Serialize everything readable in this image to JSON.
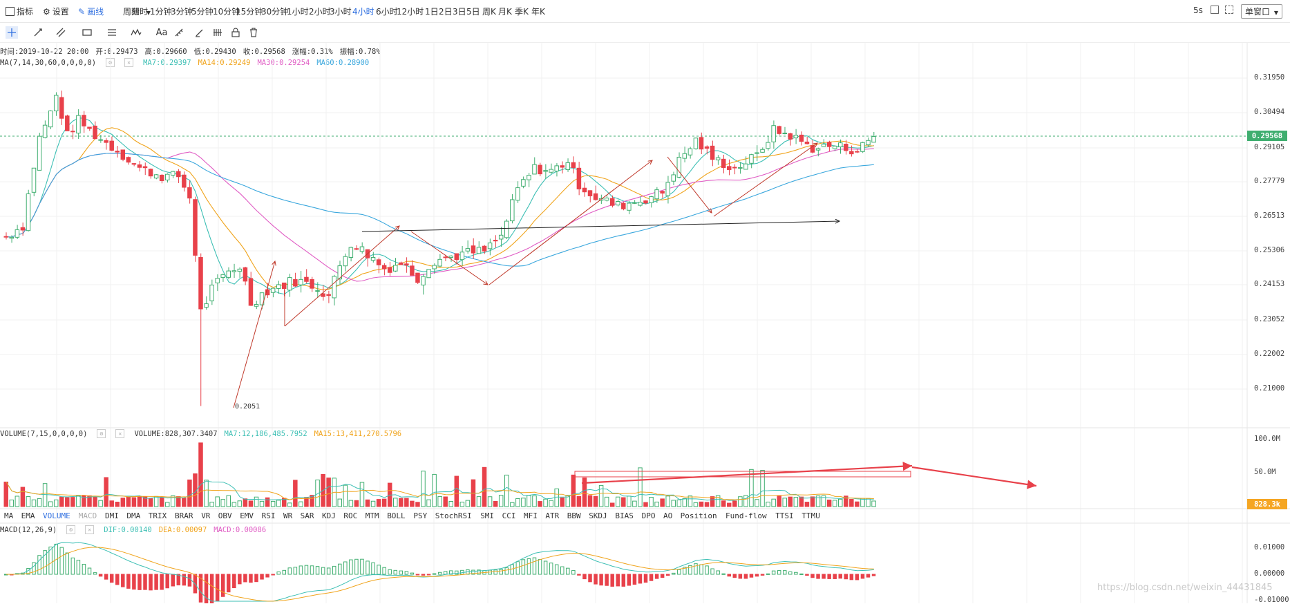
{
  "toolbar": {
    "indicator_label": "指标",
    "settings_label": "设置",
    "draw_label": "画线",
    "period_label": "周期",
    "periods": [
      "分时",
      "1分钟",
      "3分钟",
      "5分钟",
      "10分钟",
      "15分钟",
      "30分钟",
      "1小时",
      "2小时",
      "3小时",
      "4小时",
      "6小时",
      "12小时",
      "1日",
      "2日",
      "3日",
      "5日",
      "周K",
      "月K",
      "季K",
      "年K"
    ],
    "active_period": "4小时",
    "refresh": "5s",
    "window_mode": "单窗口"
  },
  "candle_info": {
    "time": "时间:2019-10-22 20:00",
    "open": "开:0.29473",
    "high": "高:0.29660",
    "low": "低:0.29430",
    "close": "收:0.29568",
    "change": "涨幅:0.31%",
    "amplitude": "振幅:0.78%"
  },
  "ma_info": {
    "params": "MA(7,14,30,60,0,0,0,0)",
    "ma7": "MA7:0.29397",
    "ma14": "MA14:0.29249",
    "ma30": "MA30:0.29254",
    "ma60": "MA60:0.28900"
  },
  "price_axis": [
    "0.31950",
    "0.30494",
    "0.29105",
    "0.27779",
    "0.26513",
    "0.25306",
    "0.24153",
    "0.23052",
    "0.22002",
    "0.21000"
  ],
  "current_price": "0.29568",
  "low_marker": "0.2051",
  "volume_info": {
    "params": "VOLUME(7,15,0,0,0,0)",
    "volume": "VOLUME:828,307.3407",
    "ma7": "MA7:12,186,485.7952",
    "ma15": "MA15:13,411,270.5796"
  },
  "volume_axis": [
    "100.0M",
    "50.0M"
  ],
  "current_volume": "828.3k",
  "indicator_tabs": [
    "MA",
    "EMA",
    "VOLUME",
    "MACD",
    "DMI",
    "DMA",
    "TRIX",
    "BRAR",
    "VR",
    "OBV",
    "EMV",
    "RSI",
    "WR",
    "SAR",
    "KDJ",
    "ROC",
    "MTM",
    "BOLL",
    "PSY",
    "StochRSI",
    "SMI",
    "CCI",
    "MFI",
    "ATR",
    "BBW",
    "SKDJ",
    "BIAS",
    "DPO",
    "AO",
    "Position",
    "Fund-flow",
    "TTSI",
    "TTMU"
  ],
  "active_indicators": [
    "VOLUME"
  ],
  "disabled_indicators": [
    "MACD"
  ],
  "macd_info": {
    "params": "MACD(12,26,9)",
    "dif": "DIF:0.00140",
    "dea": "DEA:0.00097",
    "macd": "MACD:0.00086"
  },
  "macd_axis": [
    "0.01000",
    "0.00000",
    "-0.01000"
  ],
  "watermark": "https://blog.csdn.net/weixin_44431845",
  "colors": {
    "up": "#3fae6f",
    "down": "#e8414a",
    "ma7": "#3cbfb4",
    "ma14": "#f0a41c",
    "ma30": "#e05cc4",
    "ma60": "#3aa7dd",
    "accent": "#2f6fe0",
    "current_price_tag": "#3fae6f",
    "current_volume_tag": "#f5a623"
  },
  "icons": [
    "chart-indicator-icon",
    "gear-icon",
    "pen-icon",
    "crosshair-icon",
    "line-tool-icon",
    "parallel-line-icon",
    "rectangle-icon",
    "fibonacci-icon",
    "wave-icon",
    "text-icon",
    "ruler-icon",
    "brush-icon",
    "pattern-icon",
    "lock-icon",
    "trash-icon",
    "fullscreen-icon",
    "screenshot-icon"
  ]
}
